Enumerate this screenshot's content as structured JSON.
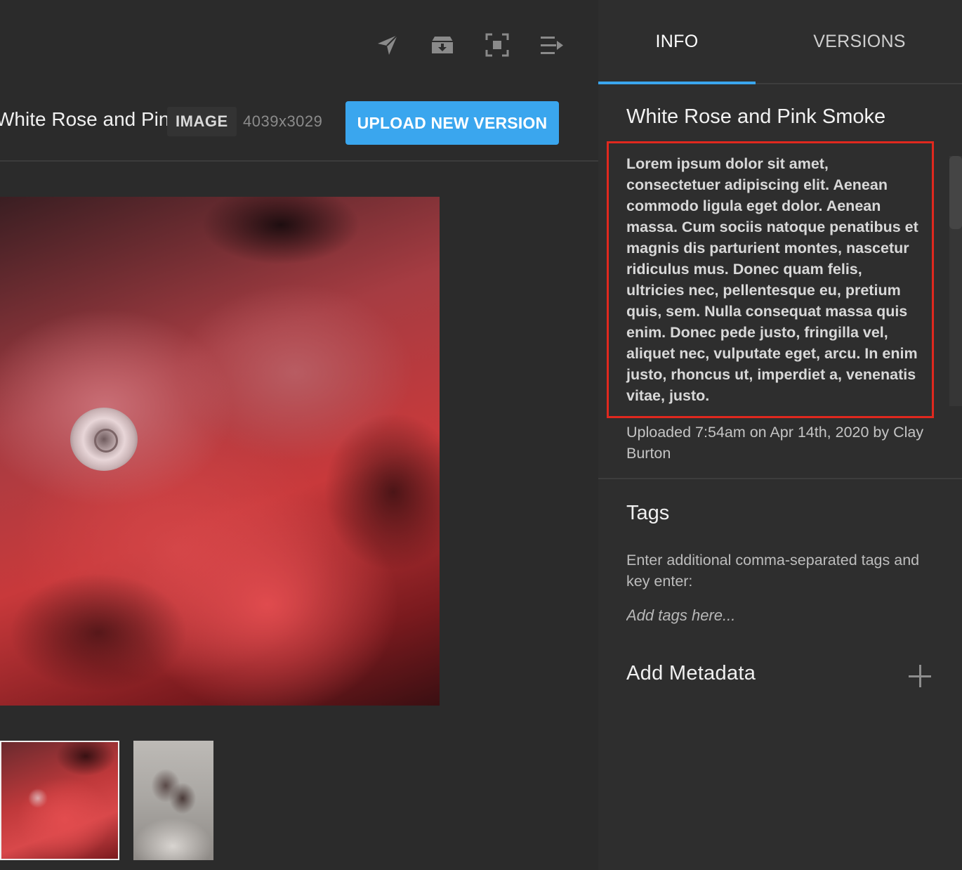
{
  "toolbar": {
    "icons": [
      "send-icon",
      "archive-download-icon",
      "focus-frame-icon",
      "collapse-panel-icon"
    ]
  },
  "asset": {
    "title": "White Rose and Pink Smoke",
    "type_badge": "IMAGE",
    "dimensions": "4039x3029",
    "upload_button": "UPLOAD NEW VERSION"
  },
  "panel": {
    "tabs": [
      {
        "label": "INFO",
        "active": true
      },
      {
        "label": "VERSIONS",
        "active": false
      }
    ],
    "title": "White Rose and Pink Smoke",
    "description": "Lorem ipsum dolor sit amet, consectetuer adipiscing elit. Aenean commodo ligula eget dolor. Aenean massa. Cum sociis natoque penatibus et magnis dis parturient montes, nascetur ridiculus mus. Donec quam felis, ultricies nec, pellentesque eu, pretium quis, sem. Nulla consequat massa quis enim. Donec pede justo, fringilla vel, aliquet nec, vulputate eget, arcu. In enim justo, rhoncus ut, imperdiet a, venenatis vitae, justo.",
    "uploaded": "Uploaded 7:54am on Apr 14th, 2020 by Clay Burton",
    "tags": {
      "heading": "Tags",
      "help": "Enter additional comma-separated tags and key enter:",
      "placeholder": "Add tags here..."
    },
    "metadata": {
      "heading": "Add Metadata"
    }
  },
  "colors": {
    "accent": "#3aa6ee",
    "highlight_box": "#e0281e",
    "background": "#2b2b2b",
    "panel_background": "#2e2e2e"
  }
}
